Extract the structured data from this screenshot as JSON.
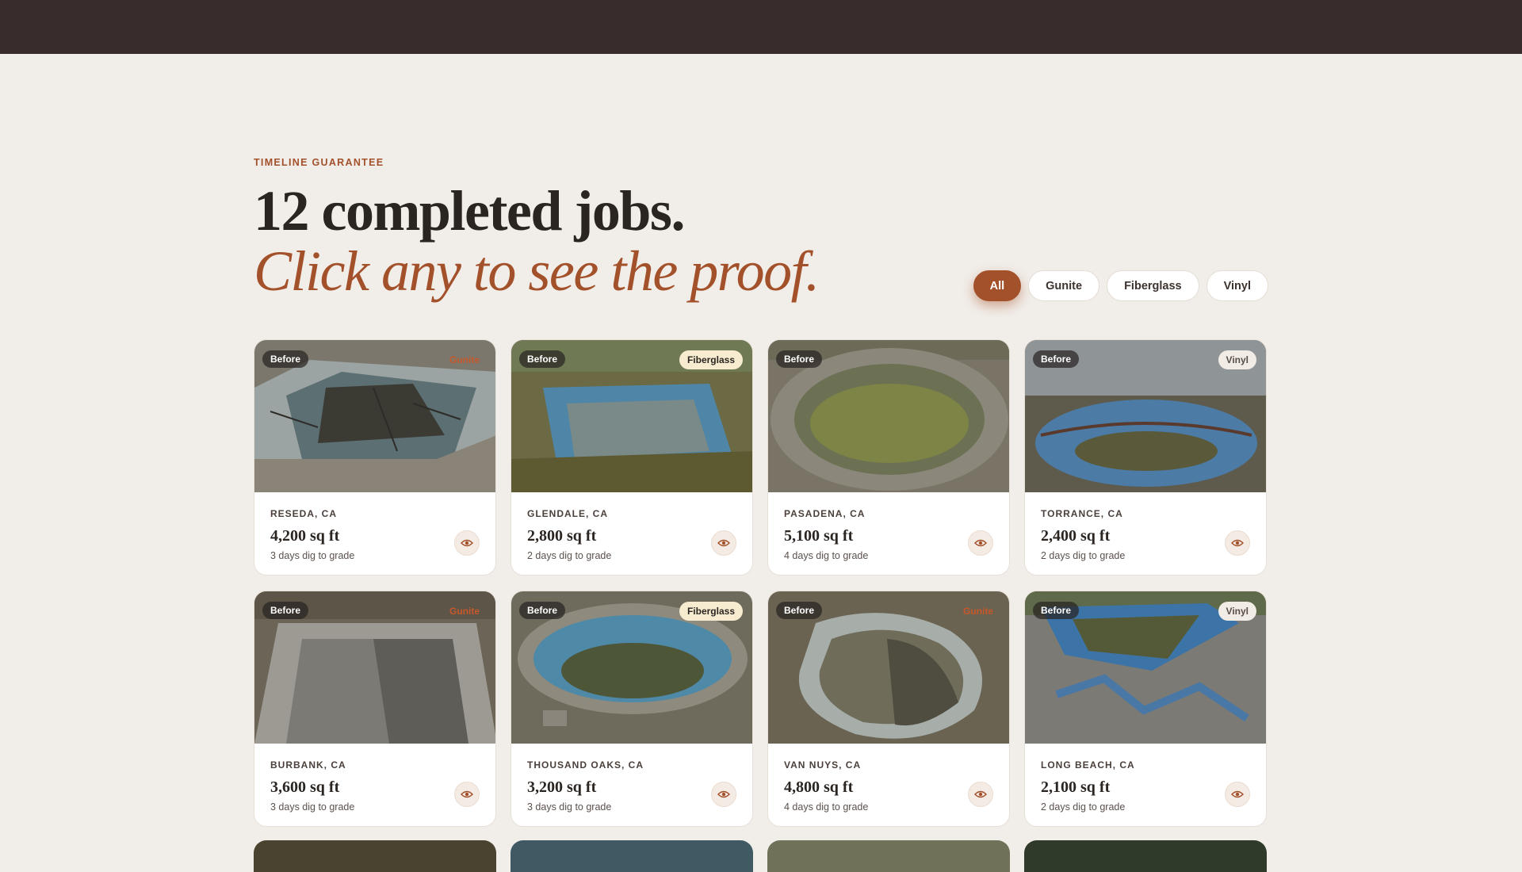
{
  "header": {},
  "section": {
    "eyebrow": "TIMELINE GUARANTEE",
    "headline": "12 completed jobs.",
    "headline_italic": "Click any to see the proof."
  },
  "filters": [
    {
      "label": "All",
      "active": true
    },
    {
      "label": "Gunite",
      "active": false
    },
    {
      "label": "Fiberglass",
      "active": false
    },
    {
      "label": "Vinyl",
      "active": false
    }
  ],
  "cards": [
    {
      "status": "Before",
      "type": "Gunite",
      "location": "RESEDA, CA",
      "size": "4,200 sq ft",
      "timeline": "3 days dig to grade"
    },
    {
      "status": "Before",
      "type": "Fiberglass",
      "location": "GLENDALE, CA",
      "size": "2,800 sq ft",
      "timeline": "2 days dig to grade"
    },
    {
      "status": "Before",
      "type": "",
      "location": "PASADENA, CA",
      "size": "5,100 sq ft",
      "timeline": "4 days dig to grade"
    },
    {
      "status": "Before",
      "type": "Vinyl",
      "location": "TORRANCE, CA",
      "size": "2,400 sq ft",
      "timeline": "2 days dig to grade"
    },
    {
      "status": "Before",
      "type": "Gunite",
      "location": "BURBANK, CA",
      "size": "3,600 sq ft",
      "timeline": "3 days dig to grade"
    },
    {
      "status": "Before",
      "type": "Fiberglass",
      "location": "THOUSAND OAKS, CA",
      "size": "3,200 sq ft",
      "timeline": "3 days dig to grade"
    },
    {
      "status": "Before",
      "type": "Gunite",
      "location": "VAN NUYS, CA",
      "size": "4,800 sq ft",
      "timeline": "4 days dig to grade"
    },
    {
      "status": "Before",
      "type": "Vinyl",
      "location": "LONG BEACH, CA",
      "size": "2,100 sq ft",
      "timeline": "2 days dig to grade"
    }
  ],
  "icons": {
    "view": "eye-icon"
  },
  "colors": {
    "accent": "#a3512b",
    "topbar": "#382c2c",
    "background": "#f1ede8"
  }
}
